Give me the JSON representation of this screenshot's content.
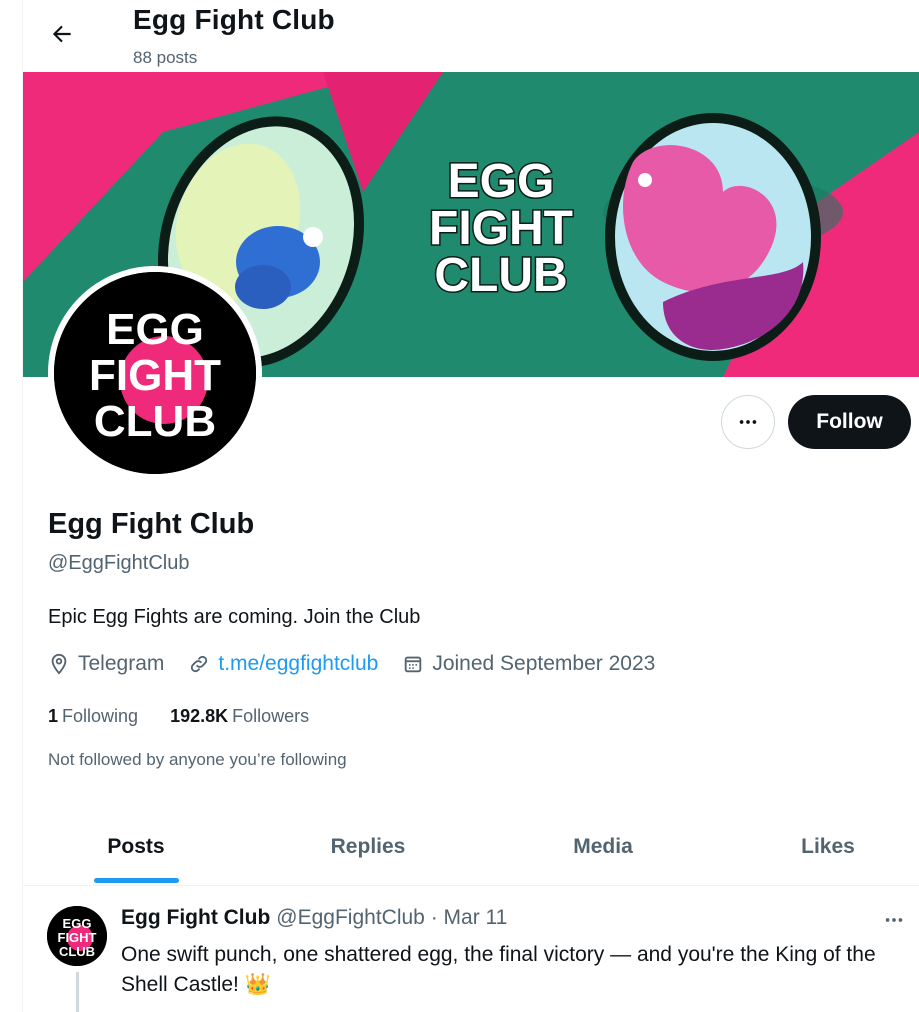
{
  "header": {
    "title": "Egg Fight Club",
    "post_count": "88 posts"
  },
  "banner": {
    "logo_lines": [
      "EGG",
      "FIGHT",
      "CLUB"
    ]
  },
  "avatar": {
    "logo_lines": [
      "EGG",
      "FIGHT",
      "CLUB"
    ]
  },
  "actions": {
    "follow_label": "Follow"
  },
  "profile": {
    "name": "Egg Fight Club",
    "handle": "@EggFightClub",
    "bio": "Epic Egg Fights are coming. Join the Club",
    "location": "Telegram",
    "website": "t.me/eggfightclub",
    "joined": "Joined September 2023",
    "following_count": "1",
    "following_label": "Following",
    "followers_count": "192.8K",
    "followers_label": "Followers",
    "not_followed_text": "Not followed by anyone you’re following"
  },
  "tabs": [
    {
      "label": "Posts",
      "active": true
    },
    {
      "label": "Replies",
      "active": false
    },
    {
      "label": "Media",
      "active": false
    },
    {
      "label": "Likes",
      "active": false
    }
  ],
  "post": {
    "author_name": "Egg Fight Club",
    "author_handle_date": "@EggFightClub · Mar 11",
    "text": "One swift punch, one shattered egg, the final victory — and you're the King of the Shell Castle! 👑"
  },
  "colors": {
    "accent": "#1d9bf0",
    "banner_pink": "#f02a7a",
    "banner_green": "#1f8a6e",
    "text_primary": "#0f1419",
    "text_secondary": "#536471"
  }
}
